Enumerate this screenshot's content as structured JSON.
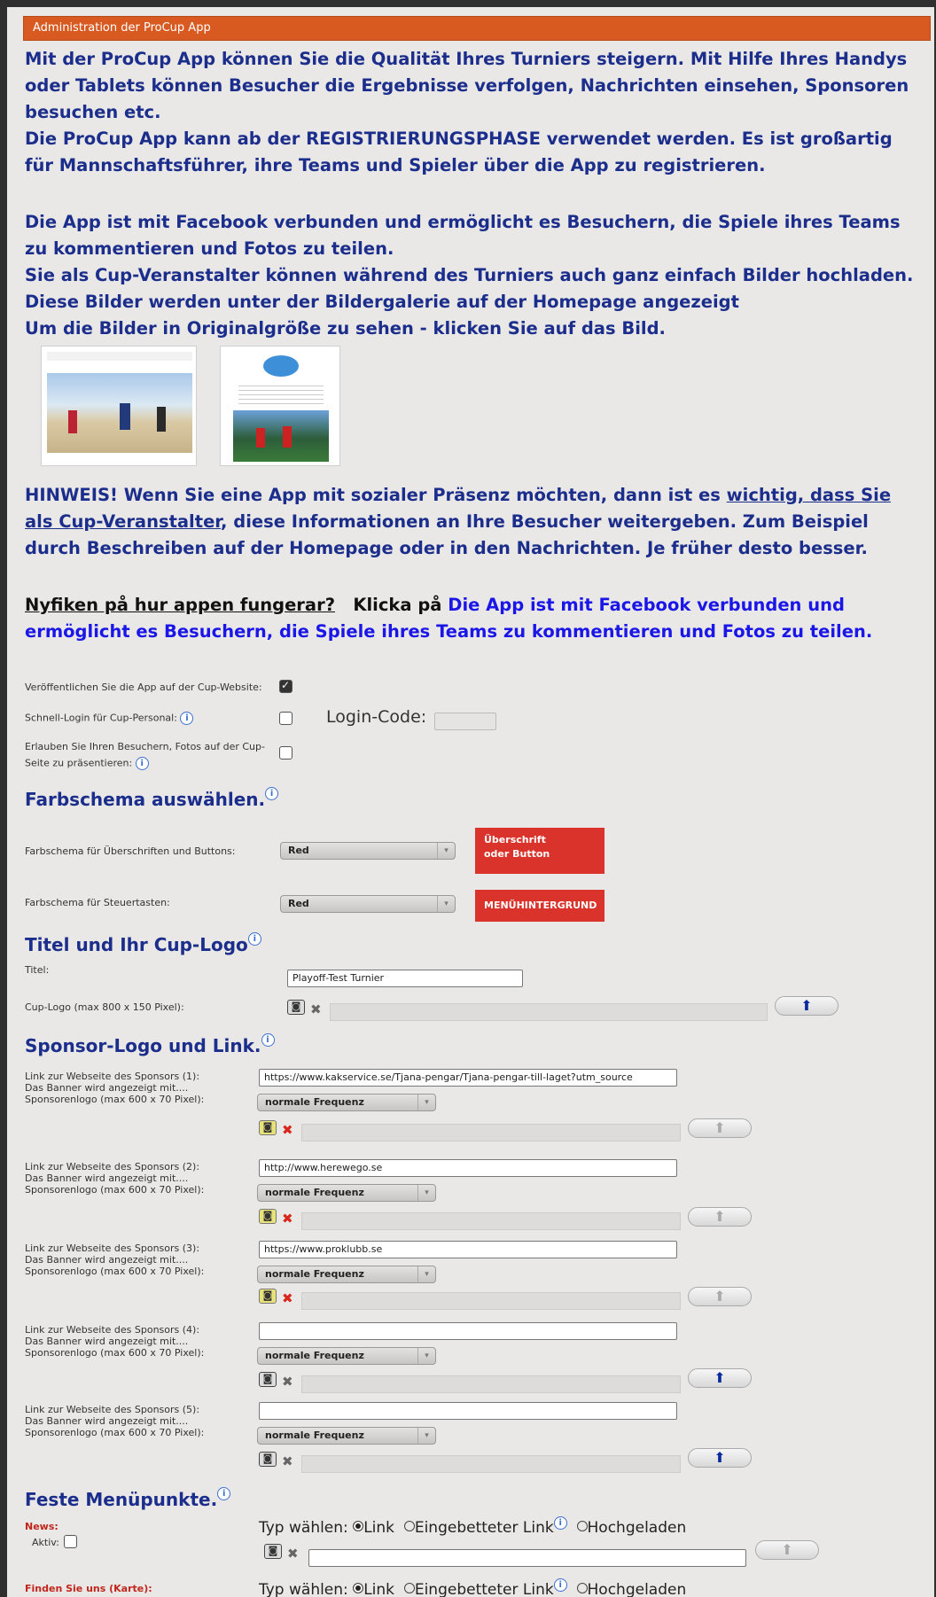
{
  "header": {
    "title": "Administration der ProCup App"
  },
  "intro": {
    "p1": "Mit der ProCup App können Sie die Qualität Ihres Turniers steigern. Mit Hilfe Ihres Handys oder Tablets können Besucher die Ergebnisse verfolgen, Nachrichten einsehen, Sponsoren besuchen etc.",
    "p2": "Die ProCup App kann ab der REGISTRIERUNGSPHASE verwendet werden. Es ist großartig für Mannschaftsführer, ihre Teams und Spieler über die App zu registrieren.",
    "p3": "Die App ist mit Facebook verbunden und ermöglicht es Besuchern, die Spiele ihres Teams zu kommentieren und Fotos zu teilen.",
    "p4": "Sie als Cup-Veranstalter können während des Turniers auch ganz einfach Bilder hochladen.",
    "p5": "Diese Bilder werden unter der Bildergalerie auf der Homepage angezeigt",
    "p6": "Um die Bilder in Originalgröße zu sehen - klicken Sie auf das Bild.",
    "hinweis_a": "HINWEIS! Wenn Sie eine App mit sozialer Präsenz möchten, dann ist es ",
    "hinweis_u": "wichtig, dass Sie als Cup-Veranstalter",
    "hinweis_b": ", diese Informationen an Ihre Besucher weitergeben. Zum Beispiel durch Beschreiben auf der Homepage oder in den Nachrichten. Je früher desto besser.",
    "nyfiken": "Nyfiken på hur appen fungerar?",
    "klicka": "Klicka på",
    "link": "Die App ist mit Facebook verbunden und ermöglicht es Besuchern, die Spiele ihres Teams zu kommentieren und Fotos zu teilen."
  },
  "settings": {
    "publish_label": "Veröffentlichen Sie die App auf der Cup-Website:",
    "publish_checked": true,
    "quick_login_label": "Schnell-Login für Cup-Personal:",
    "login_code_label": "Login-Code:",
    "login_code_value": "",
    "photos_label_1": "Erlauben Sie Ihren Besuchern, Fotos auf der Cup-",
    "photos_label_2": "Seite zu präsentieren:"
  },
  "color": {
    "title": "Farbschema auswählen.",
    "headings_label": "Farbschema für Überschriften und Buttons:",
    "headings_value": "Red",
    "headings_preview_1": "Überschrift",
    "headings_preview_2": "oder Button",
    "controls_label": "Farbschema für Steuertasten:",
    "controls_value": "Red",
    "controls_preview": "MENÜHINTERGRUND",
    "accent": "#d9332b"
  },
  "title_section": {
    "title": "Titel und Ihr Cup-Logo",
    "titel_label": "Titel:",
    "titel_value": "Playoff-Test Turnier",
    "logo_label": "Cup-Logo (max 800 x 150 Pixel):"
  },
  "sponsors": {
    "title": "Sponsor-Logo und Link.",
    "line2": "Das Banner wird angezeigt mit....",
    "logo_label": "Sponsorenlogo (max 600 x 70 Pixel):",
    "items": [
      {
        "label": "Link zur Webseite des Sponsors (1):",
        "url": "https://www.kakservice.se/Tjana-pengar/Tjana-pengar-till-laget?utm_source",
        "freq": "normale Frequenz"
      },
      {
        "label": "Link zur Webseite des Sponsors (2):",
        "url": "http://www.herewego.se",
        "freq": "normale Frequenz"
      },
      {
        "label": "Link zur Webseite des Sponsors (3):",
        "url": "https://www.proklubb.se",
        "freq": "normale Frequenz"
      },
      {
        "label": "Link zur Webseite des Sponsors (4):",
        "url": "",
        "freq": "normale Frequenz"
      },
      {
        "label": "Link zur Webseite des Sponsors (5):",
        "url": "",
        "freq": "normale Frequenz"
      }
    ]
  },
  "menu": {
    "title": "Feste Menüpunkte.",
    "news_label": "News:",
    "aktiv_label": "Aktiv:",
    "typ_label": "Typ wählen:",
    "opt_link": "Link",
    "opt_embedded": "Eingebetteter Link",
    "opt_uploaded": "Hochgeladen",
    "finden_label": "Finden Sie uns (Karte):"
  },
  "icons": {
    "info": "i",
    "camera": "◙",
    "delete": "✖",
    "upload": "⬆",
    "dropdown": "▾"
  }
}
